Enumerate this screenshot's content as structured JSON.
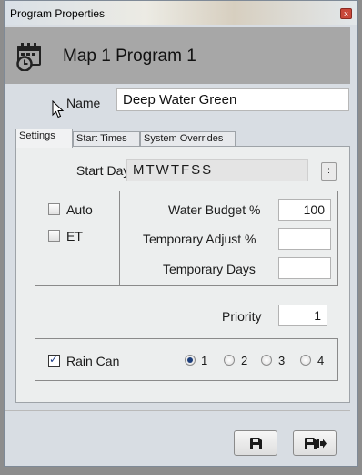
{
  "window": {
    "title": "Program Properties",
    "close_glyph": "x"
  },
  "header": {
    "title": "Map 1 Program 1",
    "icon": "calendar-clock-icon"
  },
  "name": {
    "label": "Name",
    "value": "Deep Water Green"
  },
  "tabs": [
    {
      "label": "Settings",
      "active": true
    },
    {
      "label": "Start Times",
      "active": false
    },
    {
      "label": "System Overrides",
      "active": false
    }
  ],
  "settings": {
    "start_days_label": "Start Days",
    "start_days_value": "MTWTFSS",
    "more_glyph": ":",
    "auto": {
      "label": "Auto",
      "checked": false
    },
    "et": {
      "label": "ET",
      "checked": false
    },
    "water_budget": {
      "label": "Water Budget %",
      "value": "100"
    },
    "temporary_adjust": {
      "label": "Temporary Adjust %",
      "value": ""
    },
    "temporary_days": {
      "label": "Temporary Days",
      "value": ""
    },
    "priority": {
      "label": "Priority",
      "value": "1"
    },
    "rain_can": {
      "label": "Rain Can",
      "checked": true,
      "options": [
        "1",
        "2",
        "3",
        "4"
      ],
      "selected": "1"
    }
  },
  "footer": {
    "save_icon": "floppy-disk-icon",
    "save_exit_icon": "floppy-disk-exit-icon"
  },
  "colors": {
    "header_bg": "#a7a7a7",
    "accent": "#1c3e7a",
    "close": "#c8483a"
  }
}
